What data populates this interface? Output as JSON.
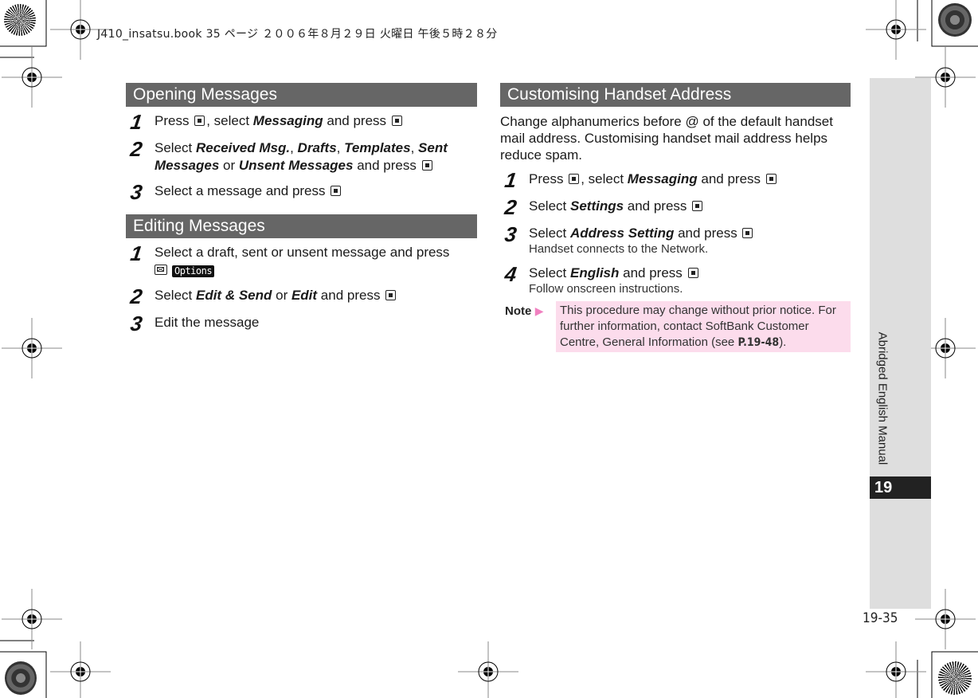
{
  "print_header": "J410_insatsu.book  35 ページ  ２００６年８月２９日  火曜日  午後５時２８分",
  "sections": {
    "opening": {
      "title": "Opening Messages",
      "step1": {
        "n": "1",
        "a": "Press ",
        "b": ", select ",
        "c": "Messaging",
        "d": " and press "
      },
      "step2": {
        "n": "2",
        "a": "Select ",
        "b": "Received Msg.",
        "c": ", ",
        "d": "Drafts",
        "e": ", ",
        "f": "Templates",
        "g": ", ",
        "h": "Sent Messages",
        "i": " or ",
        "j": "Unsent Messages",
        "k": " and press "
      },
      "step3": {
        "n": "3",
        "a": "Select a message and press "
      }
    },
    "editing": {
      "title": "Editing Messages",
      "step1": {
        "n": "1",
        "a": "Select a draft, sent or unsent message and press",
        "options": "Options"
      },
      "step2": {
        "n": "2",
        "a": "Select ",
        "b": "Edit & Send",
        "c": " or ",
        "d": "Edit",
        "e": " and press "
      },
      "step3": {
        "n": "3",
        "a": "Edit the message"
      }
    },
    "customising": {
      "title": "Customising Handset Address",
      "intro": "Change alphanumerics before @ of the default handset mail address. Customising handset mail address helps reduce spam.",
      "step1": {
        "n": "1",
        "a": "Press ",
        "b": ", select ",
        "c": "Messaging",
        "d": " and press "
      },
      "step2": {
        "n": "2",
        "a": "Select ",
        "b": "Settings",
        "c": " and press "
      },
      "step3": {
        "n": "3",
        "a": "Select ",
        "b": "Address Setting",
        "c": " and press ",
        "sub": "Handset connects to the Network."
      },
      "step4": {
        "n": "4",
        "a": "Select ",
        "b": "English",
        "c": " and press ",
        "sub": "Follow onscreen instructions."
      },
      "note": {
        "label": "Note",
        "arrow": "▶",
        "text": "This procedure may change without prior notice. For further information, contact SoftBank Customer Centre, General Information (see ",
        "ref": "P.19-48",
        "end": ")."
      }
    }
  },
  "side_tab": {
    "label": "Abridged English Manual",
    "chapter": "19"
  },
  "page_number": "19-35",
  "colors": {
    "section_header_bg": "#666666",
    "note_bg": "#fcdcec",
    "note_arrow": "#f080c0",
    "side_tab_bg": "#dedede",
    "chapter_bg": "#222222"
  }
}
